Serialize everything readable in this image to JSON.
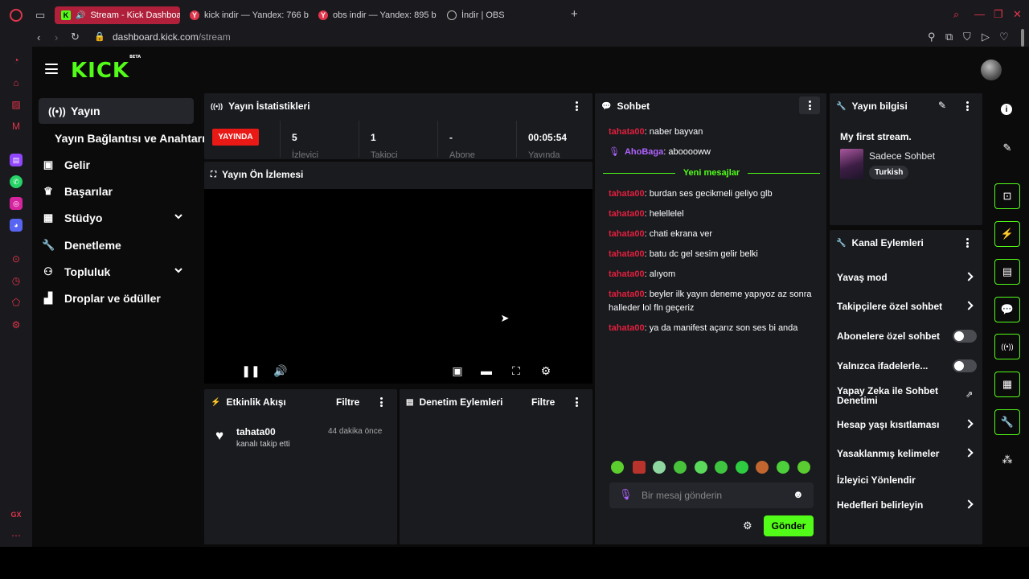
{
  "browser": {
    "tabs": [
      {
        "label": "Stream - Kick Dashboard",
        "favicon": "K"
      },
      {
        "label": "kick indir — Yandex: 766 b",
        "favicon": "Y"
      },
      {
        "label": "obs indir — Yandex: 895 b",
        "favicon": "Y"
      },
      {
        "label": "İndir | OBS",
        "favicon": ""
      }
    ],
    "url_host": "dashboard.kick.com",
    "url_path": "/stream",
    "sidebar_bottom": "GX"
  },
  "kick": {
    "logo": "KICK",
    "logo_tag": "BETA"
  },
  "nav": {
    "items": [
      {
        "label": "Yayın",
        "icon": "broadcast-icon"
      },
      {
        "label": "Gelir",
        "icon": "money-icon"
      },
      {
        "label": "Başarılar",
        "icon": "trophy-icon"
      },
      {
        "label": "Stüdyo",
        "icon": "studio-icon"
      },
      {
        "label": "Denetleme",
        "icon": "wrench-icon"
      },
      {
        "label": "Topluluk",
        "icon": "community-icon"
      },
      {
        "label": "Droplar ve ödüller",
        "icon": "gift-icon"
      }
    ],
    "sub_item": "Yayın Bağlantısı ve Anahtarı"
  },
  "stats": {
    "title": "Yayın İstatistikleri",
    "live_badge": "YAYINDA",
    "items": [
      {
        "value": "5",
        "label": "İzleyici"
      },
      {
        "value": "1",
        "label": "Takipçi"
      },
      {
        "value": "-",
        "label": "Abone"
      },
      {
        "value": "00:05:54",
        "label": "Yayında"
      }
    ]
  },
  "preview": {
    "title": "Yayın Ön İzlemesi"
  },
  "events": {
    "title": "Etkinlik Akışı",
    "filter": "Filtre",
    "items": [
      {
        "user": "tahata00",
        "action": "kanalı takip etti",
        "time": "44 dakika önce"
      }
    ]
  },
  "moderation": {
    "title": "Denetim Eylemleri",
    "filter": "Filtre"
  },
  "chat": {
    "title": "Sohbet",
    "new_messages": "Yeni mesajlar",
    "messages_before": [
      {
        "user": "tahata00",
        "text": ": naber bayvan"
      },
      {
        "user": "AhoBaga",
        "text": ": abooooww"
      }
    ],
    "messages_after": [
      {
        "user": "tahata00",
        "text": ": burdan ses gecikmeli geliyo glb"
      },
      {
        "user": "tahata00",
        "text": ": helellelel"
      },
      {
        "user": "tahata00",
        "text": ": chati ekrana ver"
      },
      {
        "user": "tahata00",
        "text": ": batu dc gel sesim gelir belki"
      },
      {
        "user": "tahata00",
        "text": ": alıyom"
      },
      {
        "user": "tahata00",
        "text": ": beyler ilk yayın deneme yapıyoz az sonra halleder lol fln geçeriz"
      },
      {
        "user": "tahata00",
        "text": ": ya da manifest açarız son ses bi anda"
      }
    ],
    "placeholder": "Bir mesaj gönderin",
    "send": "Gönder"
  },
  "stream_info": {
    "title": "Yayın bilgisi",
    "stream_title": "My first stream.",
    "category": "Sadece Sohbet",
    "tag": "Turkish"
  },
  "channel_actions": {
    "title": "Kanal Eylemleri",
    "items": [
      {
        "label": "Yavaş mod"
      },
      {
        "label": "Takipçilere özel sohbet"
      },
      {
        "label": "Abonelere özel sohbet"
      },
      {
        "label": "Yalnızca ifadelerle..."
      },
      {
        "label": "Yapay Zeka ile Sohbet Denetimi"
      },
      {
        "label": "Hesap yaşı kısıtlaması"
      },
      {
        "label": "Yasaklanmış kelimeler"
      },
      {
        "label": "İzleyici Yönlendir"
      },
      {
        "label": "Hedefleri belirleyin"
      }
    ]
  },
  "colors": {
    "kick_green": "#53fc18",
    "live_red": "#e91916",
    "panel": "#191b1f",
    "chat_user_red": "#e0203d",
    "chat_user_purple": "#b163ff"
  }
}
